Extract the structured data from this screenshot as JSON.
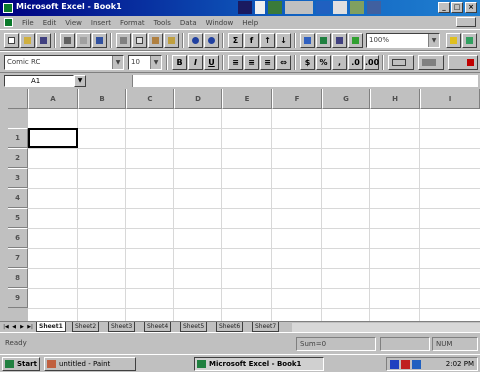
{
  "window": {
    "title": "Microsoft Excel - Book1"
  },
  "menu": [
    "File",
    "Edit",
    "View",
    "Insert",
    "Format",
    "Tools",
    "Data",
    "Window",
    "Help"
  ],
  "toolbar": {
    "zoom": "100%",
    "font_name": "Comic RC",
    "font_size": "10",
    "bold_label": "B",
    "italic_label": "I",
    "underline_label": "U"
  },
  "formula_bar": {
    "cell_ref": "A1",
    "value": ""
  },
  "grid": {
    "columns": [
      "A",
      "B",
      "C",
      "D",
      "E",
      "F",
      "G",
      "H",
      "I"
    ],
    "rows": [
      "1",
      "2",
      "3",
      "4",
      "5",
      "6",
      "7",
      "8",
      "9"
    ]
  },
  "sheets": {
    "tabs": [
      "Sheet1",
      "Sheet2",
      "Sheet3",
      "Sheet4",
      "Sheet5",
      "Sheet6",
      "Sheet7"
    ],
    "active": "Sheet1"
  },
  "status": {
    "mode": "Ready",
    "sum": "Sum=0",
    "num": "NUM"
  },
  "taskbar": {
    "start": "Start",
    "tasks": [
      "untitled - Paint",
      "Microsoft Excel - Book1"
    ],
    "clock": "2:02 PM"
  },
  "colors": {
    "title_bar": "#000080",
    "chrome": "#c0c0c0",
    "grid": "#d8d8d8"
  }
}
